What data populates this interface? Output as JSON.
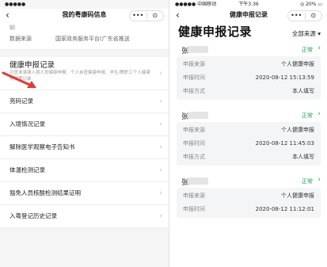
{
  "left": {
    "status": {
      "carrier": "●●●●●",
      "time": "",
      "battery": ""
    },
    "nav": {
      "back": "‹",
      "title": "我的粤康码信息",
      "capsule_more": "•••",
      "capsule_close": "⊙"
    },
    "top_fragment": "朝",
    "data_source": {
      "label": "数据来源",
      "value": "国家政务服务平台(广东省推送"
    },
    "health_item": {
      "title": "健康申报记录",
      "desc": "可查询港澳入境人员健康申报、个人自查健康申报、学生/教职工个人健康申报等记录",
      "chevron": "›"
    },
    "menu": [
      {
        "label": "亮码记录",
        "chevron": "›"
      },
      {
        "label": "入境情况记录",
        "chevron": "›"
      },
      {
        "label": "解除医学观察电子告知书",
        "chevron": "›"
      },
      {
        "label": "体温检测记录",
        "chevron": "›"
      },
      {
        "label": "豁免人员核酸检测结果证明",
        "chevron": "›"
      },
      {
        "label": "入粤登记历史记录",
        "chevron": "›"
      }
    ],
    "accent": "#e53935"
  },
  "right": {
    "status": {
      "carrier": "●●●●● 中国移动",
      "wifi": "⌔",
      "time": "下午3:36",
      "battery": "◎ 20% ▭"
    },
    "nav": {
      "back": "‹",
      "title": "健康申报记录",
      "capsule_more": "•••",
      "capsule_close": "⊙"
    },
    "heading": "健康申报记录",
    "filter": "全部来源 ▾",
    "records": [
      {
        "name": "张",
        "status": "正常",
        "chevron": "›",
        "rows": [
          {
            "k": "申报来源",
            "v": "个人健康申报"
          },
          {
            "k": "申报时间",
            "v": "2020-08-12 15:13:59"
          },
          {
            "k": "申报方式",
            "v": "本人填写"
          }
        ]
      },
      {
        "name": "张",
        "status": "正常",
        "chevron": "›",
        "rows": [
          {
            "k": "申报来源",
            "v": "个人健康申报"
          },
          {
            "k": "申报时间",
            "v": "2020-08-12 11:45:03"
          },
          {
            "k": "申报方式",
            "v": "本人填写"
          }
        ]
      },
      {
        "name": "张",
        "status": "正常",
        "chevron": "›",
        "rows": [
          {
            "k": "申报来源",
            "v": "个人健康申报"
          },
          {
            "k": "申报时间",
            "v": "2020-08-12 11:12:01"
          }
        ]
      }
    ],
    "status_color": "#18a058"
  }
}
